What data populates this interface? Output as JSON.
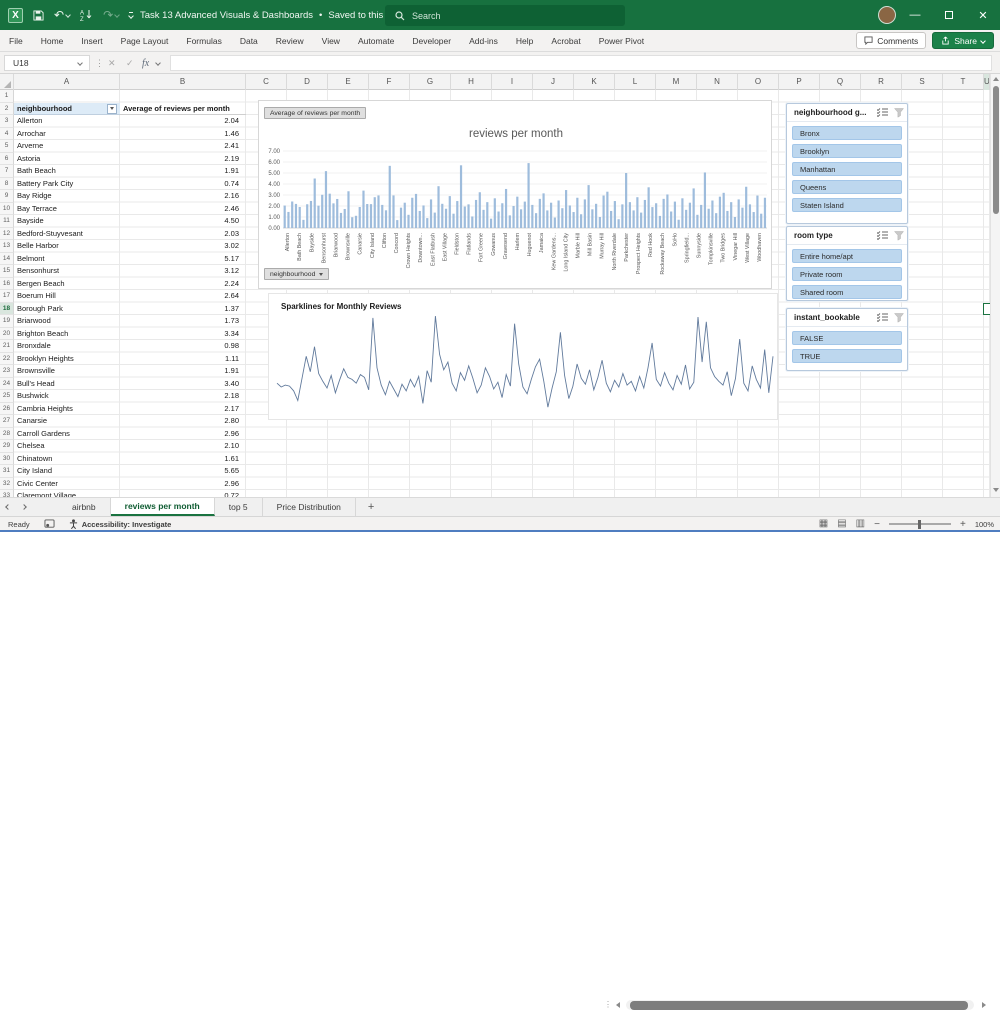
{
  "titlebar": {
    "title": "Task 13 Advanced Visuals & Dashboards",
    "separator": "•",
    "saved_status": "Saved to this PC",
    "search_placeholder": "Search"
  },
  "ribbon": {
    "tabs": [
      "File",
      "Home",
      "Insert",
      "Page Layout",
      "Formulas",
      "Data",
      "Review",
      "View",
      "Automate",
      "Developer",
      "Add-ins",
      "Help",
      "Acrobat",
      "Power Pivot"
    ],
    "comments_label": "Comments",
    "share_label": "Share"
  },
  "formula_bar": {
    "name_box_value": "U18",
    "fx_label": "fx",
    "formula_value": ""
  },
  "grid": {
    "column_letters": [
      "A",
      "B",
      "C",
      "D",
      "E",
      "F",
      "G",
      "H",
      "I",
      "J",
      "K",
      "L",
      "M",
      "N",
      "O",
      "P",
      "Q",
      "R",
      "S",
      "T",
      "U"
    ],
    "row_count": 33,
    "selected_cell": "U18",
    "selected_row": 18,
    "selected_column": "U"
  },
  "pivot_table": {
    "header_a": "neighbourhood",
    "header_b": "Average of reviews per month",
    "rows": [
      [
        "Allerton",
        "2.04"
      ],
      [
        "Arrochar",
        "1.46"
      ],
      [
        "Arverne",
        "2.41"
      ],
      [
        "Astoria",
        "2.19"
      ],
      [
        "Bath Beach",
        "1.91"
      ],
      [
        "Battery Park City",
        "0.74"
      ],
      [
        "Bay Ridge",
        "2.16"
      ],
      [
        "Bay Terrace",
        "2.46"
      ],
      [
        "Bayside",
        "4.50"
      ],
      [
        "Bedford-Stuyvesant",
        "2.03"
      ],
      [
        "Belle Harbor",
        "3.02"
      ],
      [
        "Belmont",
        "5.17"
      ],
      [
        "Bensonhurst",
        "3.12"
      ],
      [
        "Bergen Beach",
        "2.24"
      ],
      [
        "Boerum Hill",
        "2.64"
      ],
      [
        "Borough Park",
        "1.37"
      ],
      [
        "Briarwood",
        "1.73"
      ],
      [
        "Brighton Beach",
        "3.34"
      ],
      [
        "Bronxdale",
        "0.98"
      ],
      [
        "Brooklyn Heights",
        "1.11"
      ],
      [
        "Brownsville",
        "1.91"
      ],
      [
        "Bull's Head",
        "3.40"
      ],
      [
        "Bushwick",
        "2.18"
      ],
      [
        "Cambria Heights",
        "2.17"
      ],
      [
        "Canarsie",
        "2.80"
      ],
      [
        "Carroll Gardens",
        "2.96"
      ],
      [
        "Chelsea",
        "2.10"
      ],
      [
        "Chinatown",
        "1.61"
      ],
      [
        "City Island",
        "5.65"
      ],
      [
        "Civic Center",
        "2.96"
      ],
      [
        "Claremont Village",
        "0.72"
      ]
    ]
  },
  "chart_data": [
    {
      "type": "bar",
      "title": "reviews per month",
      "value_field_button": "Average of reviews per month",
      "axis_field_button": "neighbourhood",
      "xlabel": "",
      "ylabel": "",
      "ylim": [
        0,
        7
      ],
      "grid": true,
      "legend": "none",
      "bar_color": "#9EBCDC",
      "y_ticks": [
        "7.00",
        "6.00",
        "5.00",
        "4.00",
        "3.00",
        "2.00",
        "1.00",
        "0.00"
      ],
      "axis_labels": [
        "Allerton",
        "Bath Beach",
        "Bayside",
        "Bensonhurst",
        "Briarwood",
        "Brownsville",
        "Canarsie",
        "City Island",
        "Clifton",
        "Concord",
        "Crown Heights",
        "Downtown...",
        "East Flatbush",
        "East Village",
        "Fieldston",
        "Flatlands",
        "Fort Greene",
        "Gowanus",
        "Gravesend",
        "Harlem",
        "Huguenot",
        "Jamaica",
        "Kew Gardens...",
        "Long Island City",
        "Marble Hill",
        "Mill Basin",
        "Murray Hill",
        "North Riverdale",
        "Parkchester",
        "Prospect Heights",
        "Red Hook",
        "Rockaway Beach",
        "SoHo",
        "Springfield...",
        "Sunnyside",
        "Tompkinsville",
        "Two Bridges",
        "Vinegar Hill",
        "West Village",
        "Woodhaven"
      ],
      "values": [
        2.04,
        1.46,
        2.41,
        2.19,
        1.91,
        0.74,
        2.16,
        2.46,
        4.5,
        2.03,
        3.02,
        5.17,
        3.12,
        2.24,
        2.64,
        1.37,
        1.73,
        3.34,
        0.98,
        1.11,
        1.91,
        3.4,
        2.18,
        2.17,
        2.8,
        2.96,
        2.1,
        1.61,
        5.65,
        2.96,
        0.72,
        1.85,
        2.3,
        1.2,
        2.75,
        3.1,
        1.55,
        2.05,
        0.9,
        2.6,
        1.4,
        3.8,
        2.2,
        1.75,
        2.9,
        1.3,
        2.45,
        5.7,
        1.95,
        2.15,
        1.05,
        2.55,
        3.25,
        1.65,
        2.35,
        0.85,
        2.7,
        1.5,
        2.25,
        3.55,
        1.15,
        2.0,
        2.85,
        1.7,
        2.4,
        5.9,
        2.1,
        1.35,
        2.65,
        3.15,
        1.6,
        2.3,
        0.95,
        2.5,
        1.8,
        3.45,
        2.05,
        1.45,
        2.75,
        1.25,
        2.6,
        3.9,
        1.7,
        2.2,
        1.0,
        2.95,
        3.3,
        1.55,
        2.45,
        0.8,
        2.15,
        5.0,
        2.35,
        1.6,
        2.8,
        1.4,
        2.55,
        3.7,
        1.9,
        2.25,
        1.1,
        2.65,
        3.05,
        1.5,
        2.4,
        0.75,
        2.7,
        1.65,
        2.3,
        3.6,
        1.2,
        2.1,
        5.05,
        1.75,
        2.5,
        1.35,
        2.85,
        3.2,
        1.55,
        2.35,
        1.0,
        2.6,
        1.85,
        3.75,
        2.15,
        1.45,
        2.95,
        1.3,
        2.75
      ]
    },
    {
      "type": "line",
      "title": "Sparklines for Monthly Reviews",
      "line_color": "#617A9C",
      "ylim": [
        0,
        10
      ],
      "values": [
        3.0,
        2.6,
        2.8,
        2.7,
        2.2,
        1.2,
        3.5,
        5.8,
        4.2,
        6.8,
        4.0,
        3.2,
        2.5,
        3.8,
        2.0,
        3.3,
        4.5,
        3.6,
        3.4,
        3.0,
        3.9,
        3.6,
        2.3,
        9.8,
        4.6,
        2.8,
        1.8,
        3.2,
        2.4,
        1.6,
        2.9,
        2.2,
        3.4,
        2.6,
        3.7,
        0.9,
        4.3,
        3.1,
        10.0,
        6.0,
        4.4,
        5.2,
        3.0,
        2.2,
        4.1,
        3.3,
        4.8,
        3.5,
        2.0,
        2.8,
        4.6,
        3.7,
        2.4,
        3.1,
        1.5,
        3.9,
        2.7,
        9.2,
        5.0,
        2.6,
        1.9,
        3.4,
        4.7,
        5.5,
        3.2,
        0.5,
        2.5,
        4.2,
        8.3,
        3.8,
        1.4,
        2.7,
        5.0,
        3.5,
        2.9,
        4.4,
        2.3,
        3.6,
        5.4,
        3.0,
        2.1,
        3.3,
        2.6,
        4.0,
        2.8,
        3.2,
        2.2,
        3.7,
        2.5,
        4.6,
        7.2,
        3.4,
        2.7,
        4.1,
        3.0,
        2.3,
        3.8,
        2.9,
        4.9,
        2.4,
        3.1,
        9.9,
        5.2,
        9.4,
        4.6,
        3.7,
        3.2,
        2.8,
        4.2,
        1.7,
        3.5,
        7.6,
        3.0,
        2.2,
        4.8,
        3.4,
        2.5,
        6.5,
        2.0,
        5.8
      ]
    }
  ],
  "slicers": [
    {
      "title": "neighbourhood g...",
      "items": [
        "Bronx",
        "Brooklyn",
        "Manhattan",
        "Queens",
        "Staten Island"
      ],
      "item_color": "#BDD7EE"
    },
    {
      "title": "room type",
      "items": [
        "Entire home/apt",
        "Private room",
        "Shared room"
      ],
      "item_color": "#BDD7EE"
    },
    {
      "title": "instant_bookable",
      "items": [
        "FALSE",
        "TRUE"
      ],
      "item_color": "#BDD7EE"
    }
  ],
  "sheet_tabs": {
    "items": [
      "airbnb",
      "reviews per month",
      "top 5",
      "Price Distribution"
    ],
    "active_index": 1,
    "add_label": "+"
  },
  "status_bar": {
    "mode": "Ready",
    "accessibility": "Accessibility: Investigate",
    "zoom_level": "100%"
  },
  "icons": {
    "excel-logo": "green-grid-x",
    "save": "floppy",
    "undo": "arrow-curl-left",
    "sort-az": "a-z-down-arrow",
    "redo": "arrow-curl-right",
    "search": "magnifier",
    "minimize": "dash",
    "restore": "square",
    "close": "x",
    "comments": "speech-bubble",
    "share": "box-up-arrow",
    "filter": "funnel",
    "multi-select": "checklist",
    "macro-record": "record-square",
    "accessibility": "person",
    "view-normal": "grid",
    "view-page-layout": "page",
    "view-page-break": "page-dashed"
  }
}
